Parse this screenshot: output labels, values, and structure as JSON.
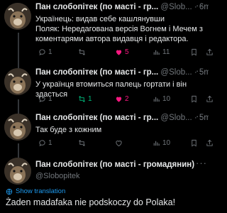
{
  "posts": [
    {
      "name": "Пан слобопітек (по масті - гр...",
      "handle": "@Slob...",
      "time": "· 6m",
      "text": "Українець: видав себе кашлянувши\nПоляк: Нередагована версія Вогнем і Мечем з коментарями автора видавця і редактора.",
      "replies": "1",
      "retweets": "",
      "likes": "5",
      "views": "11"
    },
    {
      "name": "Пан слобопітек (по масті - гр...",
      "handle": "@Slob...",
      "time": "· 5m",
      "text": "У українця втомиться палець гортати і він здасться",
      "replies": "1",
      "retweets": "1",
      "likes": "2",
      "views": "10"
    },
    {
      "name": "Пан слобопітек (по масті - гр...",
      "handle": "@Slob...",
      "time": "· 5m",
      "text": "Так буде з кожним",
      "replies": "1",
      "retweets": "",
      "likes": "",
      "views": "10"
    },
    {
      "name": "Пан слобопітек (по масті - громадянин)",
      "handle": "@Slobopitek"
    }
  ],
  "translate_label": "Show translation",
  "main_text": "Żaden madafaka nie podskoczy do Polaka!",
  "more_label": "···",
  "colors": {
    "background": "#000000",
    "muted": "#71767b",
    "link": "#1d9bf0",
    "retweet": "#00ba7c",
    "like": "#f91880"
  }
}
